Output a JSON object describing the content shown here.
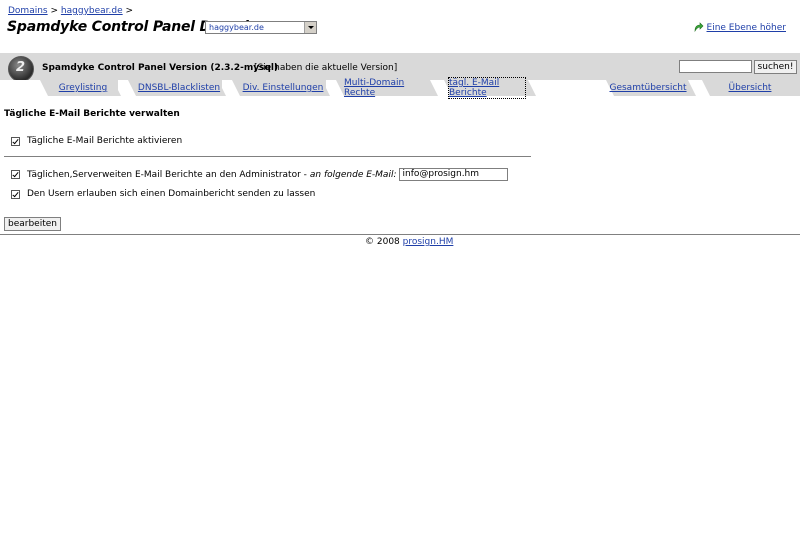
{
  "breadcrumb": {
    "domains_link": "Domains",
    "separator": ">",
    "domain_link": "haggybear.de",
    "trailing_separator": ">"
  },
  "header": {
    "title": "Spamdyke Control Panel Domain",
    "domain_select_value": "haggybear.de",
    "up_link": "Eine Ebene höher",
    "up_icon": "arrow-up-green-icon"
  },
  "panel": {
    "logo_icon": "spamdyke-logo-icon",
    "title": "Spamdyke Control Panel Version (2.3.2-mysql)",
    "version_note": "[Sie haben die aktuelle Version]",
    "search_placeholder": "",
    "search_button": "suchen!"
  },
  "tabs": [
    {
      "label": "Greylisting"
    },
    {
      "label": "DNSBL-Blacklisten"
    },
    {
      "label": "Div. Einstellungen"
    },
    {
      "label": "Multi-Domain Rechte"
    },
    {
      "label": "tägl. E-Mail Berichte",
      "active": true
    },
    {
      "label": "Gesamtübersicht"
    },
    {
      "label": "Übersicht"
    }
  ],
  "main": {
    "section_title": "Tägliche E-Mail Berichte verwalten",
    "option_daily_reports": "Tägliche E-Mail Berichte aktivieren",
    "option_server_reports": "Täglichen,Serverweiten E-Mail Berichte an den Administrator -",
    "option_server_reports_hint": "an folgende E-Mail:",
    "admin_email": "info@prosign.hm",
    "option_user_reports": "Den Usern erlauben sich einen Domainbericht senden zu lassen",
    "edit_button": "bearbeiten"
  },
  "footer": {
    "copyright": "© 2008",
    "link": "prosign.HM"
  },
  "colors": {
    "panel_bg": "#d9d9d9",
    "link": "#1f3fa8"
  }
}
